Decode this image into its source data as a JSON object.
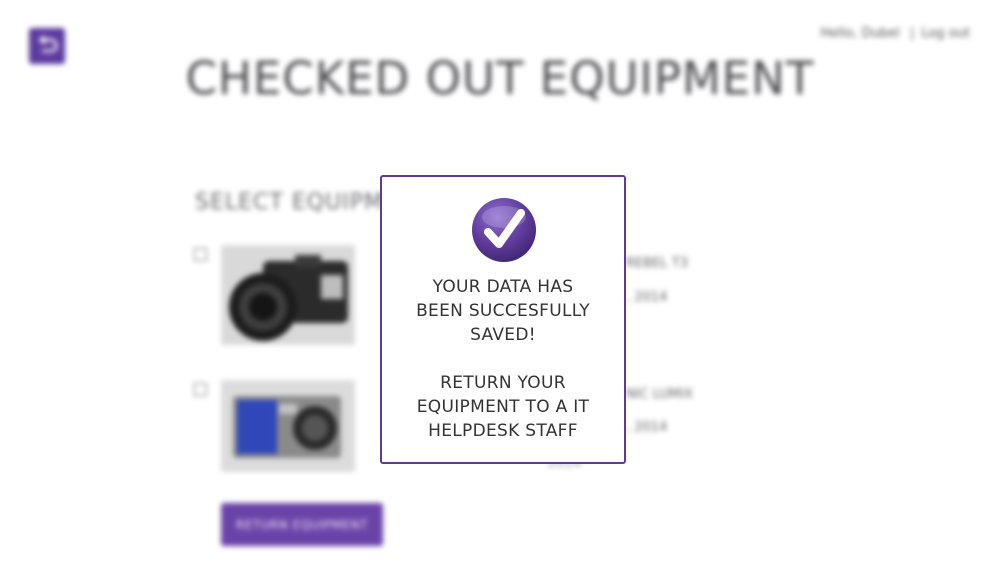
{
  "header": {
    "greeting": "Hello, Dubel",
    "separator": "|",
    "logout_label": "Log out"
  },
  "page": {
    "title": "CHECKED OUT EQUIPMENT",
    "section_heading": "SELECT EQUIPME"
  },
  "equipment": [
    {
      "name_fragment": "REBEL T3",
      "date_fragment": ", 2014"
    },
    {
      "name_fragment": "NIC LUMIX",
      "date_fragment": ", 2014",
      "extra_fragment": "2014"
    }
  ],
  "actions": {
    "return_label": "RETURN EQUIPMENT"
  },
  "modal": {
    "saved_message": [
      "YOUR DATA HAS",
      "BEEN SUCCESFULLY",
      "SAVED!"
    ],
    "return_message": [
      "RETURN YOUR",
      "EQUIPMENT TO A IT",
      "HELPDESK STAFF"
    ]
  },
  "colors": {
    "brand_purple": "#5e3b9a",
    "button_purple": "#6a43a8"
  },
  "icons": {
    "back": "return-arrow-icon",
    "success": "checkmark-circle-icon"
  }
}
